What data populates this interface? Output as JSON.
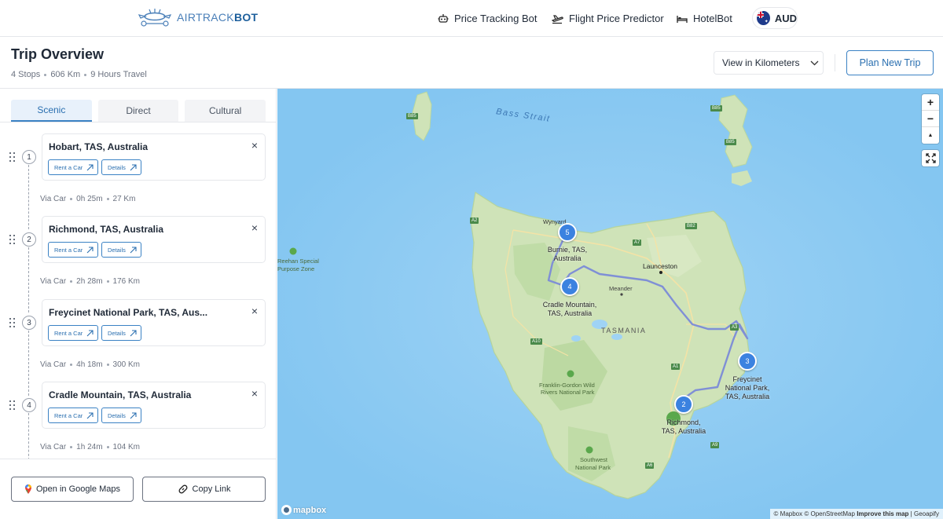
{
  "header": {
    "logo_light": "AIRTRACK",
    "logo_bold": "BOT",
    "nav": [
      {
        "label": "Price Tracking Bot",
        "icon": "robot-icon"
      },
      {
        "label": "Flight Price Predictor",
        "icon": "plane-icon"
      },
      {
        "label": "HotelBot",
        "icon": "bed-icon"
      }
    ],
    "currency": "AUD"
  },
  "overview": {
    "title": "Trip Overview",
    "stops": "4 Stops",
    "distance": "606 Km",
    "travel": "9 Hours Travel",
    "unit_select": "View in Kilometers",
    "plan_button": "Plan New Trip"
  },
  "tabs": [
    {
      "label": "Scenic",
      "active": true
    },
    {
      "label": "Direct",
      "active": false
    },
    {
      "label": "Cultural",
      "active": false
    }
  ],
  "stops": [
    {
      "num": "1",
      "name": "Hobart, TAS, Australia"
    },
    {
      "num": "2",
      "name": "Richmond, TAS, Australia"
    },
    {
      "num": "3",
      "name": "Freycinet National Park, TAS, Aus..."
    },
    {
      "num": "4",
      "name": "Cradle Mountain, TAS, Australia"
    }
  ],
  "legs": [
    {
      "mode": "Via Car",
      "time": "0h 25m",
      "dist": "27 Km"
    },
    {
      "mode": "Via Car",
      "time": "2h 28m",
      "dist": "176 Km"
    },
    {
      "mode": "Via Car",
      "time": "4h 18m",
      "dist": "300 Km"
    },
    {
      "mode": "Via Car",
      "time": "1h 24m",
      "dist": "104 Km"
    }
  ],
  "card_buttons": {
    "rent": "Rent a Car",
    "details": "Details",
    "close": "×"
  },
  "bottom": {
    "google": "Open in Google Maps",
    "copy": "Copy Link"
  },
  "map": {
    "sea_label": "Bass Strait",
    "region_label": "TASMANIA",
    "markers": [
      {
        "num": "5",
        "label": [
          "Burnie, TAS,",
          "Australia"
        ]
      },
      {
        "num": "4",
        "label": [
          "Cradle Mountain,",
          "TAS, Australia"
        ]
      },
      {
        "num": "3",
        "label": [
          "Freycinet",
          "National Park,",
          "TAS, Australia"
        ]
      },
      {
        "num": "2",
        "label": [
          "Richmond,",
          "TAS, Australia"
        ]
      }
    ],
    "places": [
      "Wynyard",
      "Launceston",
      "Meander",
      "Franklin-Gordon Wild",
      "Rivers National Park",
      "Southwest",
      "National Park",
      "Reehan Special",
      "Purpose Zone"
    ],
    "road_shields": [
      "B85",
      "B85",
      "B85",
      "A2",
      "A7",
      "B82",
      "A10",
      "A1",
      "A3",
      "A6",
      "A9"
    ],
    "controls": {
      "zoom_in": "+",
      "zoom_out": "−",
      "compass": "▲",
      "fullscreen": "⛶"
    },
    "attribution": {
      "a": "© Mapbox © OpenStreetMap",
      "b": "Improve this map",
      "c": "| Geoapify"
    },
    "brand": "mapbox"
  },
  "colors": {
    "accent": "#3b82c4",
    "route": "#7f8fd6",
    "marker": "#3b82e0",
    "land": "#cfe3b8",
    "water": "#84c6f1"
  }
}
